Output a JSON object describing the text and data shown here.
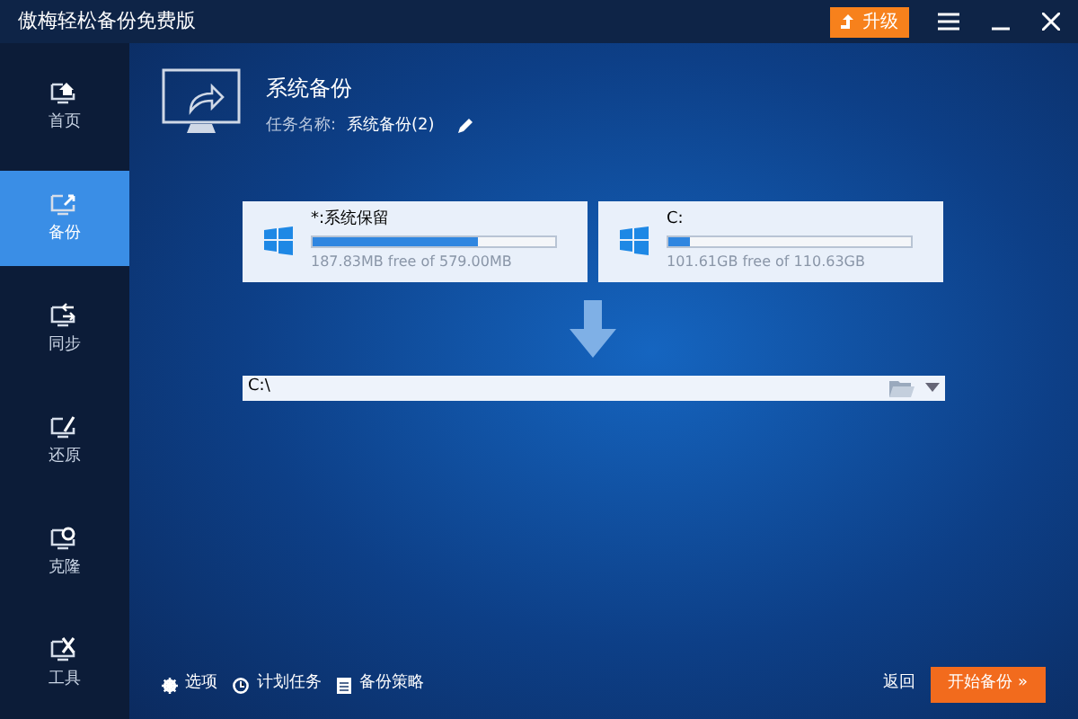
{
  "window": {
    "title": "傲梅轻松备份免费版",
    "upgrade": "升级"
  },
  "sidebar": {
    "items": [
      {
        "label": "首页",
        "kind": "home",
        "selected": false
      },
      {
        "label": "备份",
        "kind": "backup",
        "selected": true
      },
      {
        "label": "同步",
        "kind": "sync",
        "selected": false
      },
      {
        "label": "还原",
        "kind": "restore",
        "selected": false
      },
      {
        "label": "克隆",
        "kind": "clone",
        "selected": false
      },
      {
        "label": "工具",
        "kind": "tools",
        "selected": false
      }
    ]
  },
  "header": {
    "title": "系统备份",
    "task_label": "任务名称:",
    "task_name": "系统备份(2)"
  },
  "sources": [
    {
      "name": "*:系统保留",
      "level": 0.68,
      "detail": "187.83MB free of 579.00MB"
    },
    {
      "name": "C:",
      "level": 0.09,
      "detail": "101.61GB free of 110.63GB"
    }
  ],
  "destination": {
    "value": "C:\\"
  },
  "footer": {
    "links": [
      {
        "label": "选项",
        "kind": "options"
      },
      {
        "label": "计划任务",
        "kind": "schedule"
      },
      {
        "label": "备份策略",
        "kind": "scheme"
      }
    ],
    "back": "返回",
    "start": "开始备份 »"
  }
}
